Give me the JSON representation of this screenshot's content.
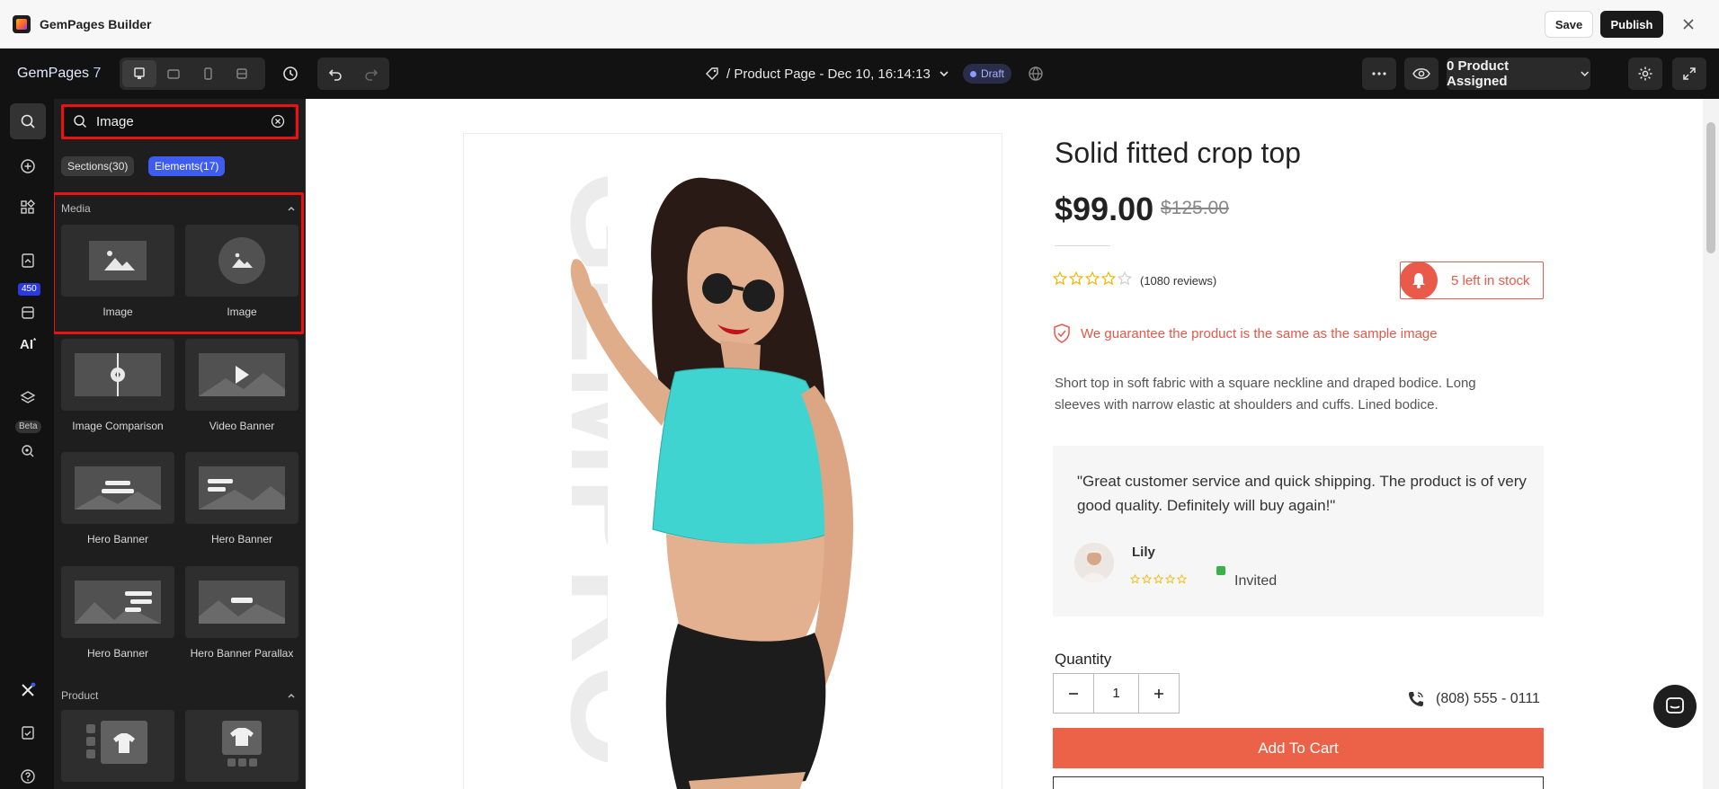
{
  "window": {
    "app_title": "GemPages Builder",
    "save_label": "Save",
    "publish_label": "Publish"
  },
  "toolbar": {
    "brand": "GemPages",
    "brand_version": "7",
    "page_title": "/ Product Page - Dec 10, 16:14:13",
    "status_badge": "Draft",
    "assigned_label": "0 Product Assigned"
  },
  "rail": {
    "badge_count": "450",
    "ai_label": "AI",
    "beta_label": "Beta"
  },
  "panel": {
    "search_value": "Image",
    "chips": {
      "sections": "Sections(30)",
      "elements": "Elements(17)"
    },
    "groups": [
      {
        "title": "Media",
        "items": [
          {
            "label": "Image",
            "icon": "image-icon"
          },
          {
            "label": "Image",
            "icon": "image-circle-icon"
          },
          {
            "label": "Image Comparison",
            "icon": "image-comparison-icon"
          },
          {
            "label": "Video Banner",
            "icon": "video-banner-icon"
          },
          {
            "label": "Hero Banner",
            "icon": "hero-banner-icon"
          },
          {
            "label": "Hero Banner",
            "icon": "hero-banner-icon"
          },
          {
            "label": "Hero Banner",
            "icon": "hero-banner-icon"
          },
          {
            "label": "Hero Banner Parallax",
            "icon": "hero-banner-parallax-icon"
          }
        ]
      },
      {
        "title": "Product",
        "items": [
          {
            "label": "",
            "icon": "product-images-icon"
          },
          {
            "label": "",
            "icon": "product-image-icon"
          }
        ]
      }
    ]
  },
  "product": {
    "title": "Solid fitted crop top",
    "price": "$99.00",
    "compare_price": "$125.00",
    "rating": 4,
    "reviews": "(1080 reviews)",
    "stock": "5 left in stock",
    "guarantee": "We guarantee the product is the same as the sample image",
    "description": "Short top in soft fabric with a square neckline and draped bodice. Long sleeves with narrow elastic at shoulders and cuffs. Lined bodice.",
    "testimonial": {
      "quote": "\"Great customer service and quick shipping. The product is of very good quality. Definitely will buy again!\"",
      "name": "Lily",
      "rating": 5,
      "invited": "Invited"
    },
    "quantity_label": "Quantity",
    "quantity": "1",
    "phone": "(808) 555 - 0111",
    "add_to_cart": "Add To Cart",
    "watermark": "GEMPRO"
  },
  "colors": {
    "accent_red": "#ec6248",
    "publish_bg": "#1a1a1a",
    "chip_active": "#3e5cf0",
    "annotation_red": "#e11111",
    "star": "#f0b400"
  }
}
